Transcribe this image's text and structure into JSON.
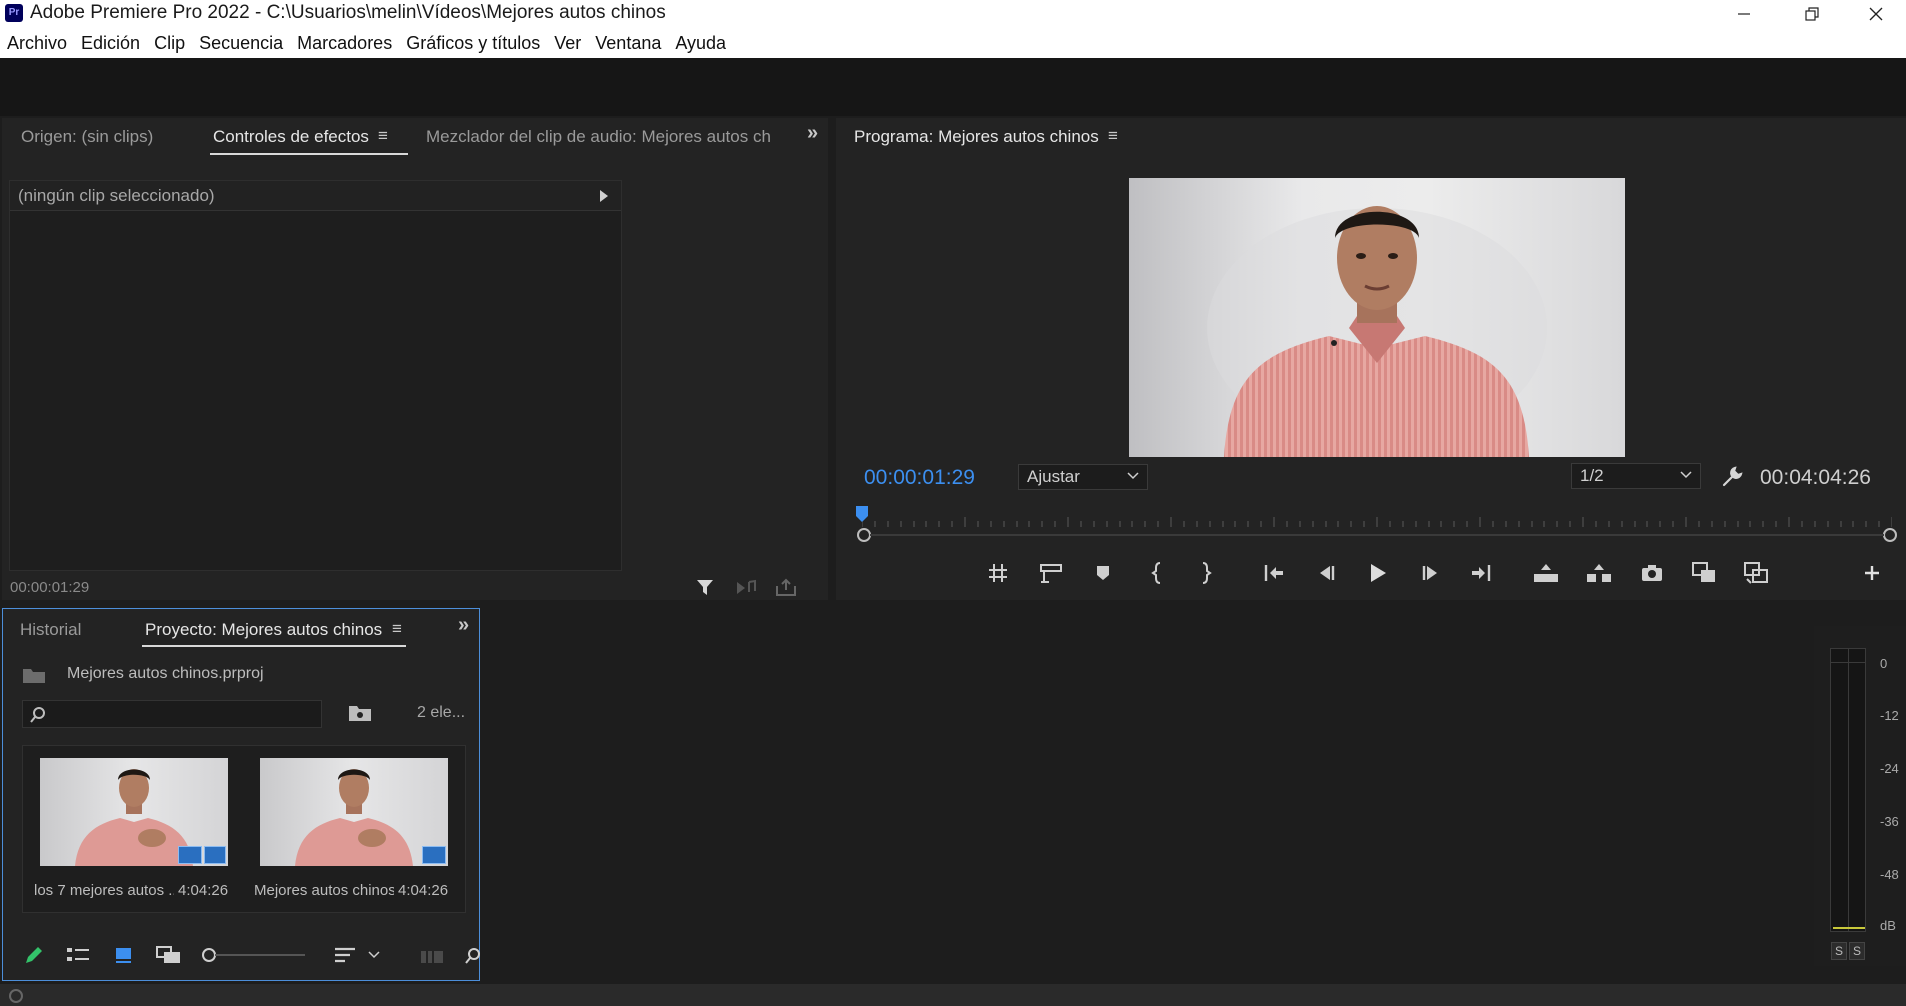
{
  "window": {
    "app_icon": "Pr",
    "title": "Adobe Premiere Pro 2022 - C:\\Usuarios\\melin\\Vídeos\\Mejores autos chinos"
  },
  "menubar": [
    "Archivo",
    "Edición",
    "Clip",
    "Secuencia",
    "Marcadores",
    "Gráficos y títulos",
    "Ver",
    "Ventana",
    "Ayuda"
  ],
  "source_panel": {
    "tabs": [
      "Origen: (sin clips)",
      "Controles de efectos",
      "Mezclador del clip de audio: Mejores autos chi"
    ],
    "active_tab": "Controles de efectos",
    "no_clip_text": "(ningún clip seleccionado)",
    "timecode": "00:00:01:29"
  },
  "program_panel": {
    "title": "Programa: Mejores autos chinos",
    "current_timecode": "00:00:01:29",
    "zoom": "Ajustar",
    "resolution": "1/2",
    "duration": "00:04:04:26",
    "playhead_fraction": 0.0
  },
  "project_panel": {
    "tabs": [
      "Historial",
      "Proyecto: Mejores autos chinos"
    ],
    "active_tab": "Proyecto: Mejores autos chinos",
    "project_file": "Mejores autos chinos.prproj",
    "search_placeholder": "",
    "item_count": "2 ele...",
    "items": [
      {
        "name": "los 7 mejores autos ...",
        "duration": "4:04:26"
      },
      {
        "name": "Mejores autos chinos",
        "duration": "4:04:26"
      }
    ]
  },
  "audio_meter": {
    "scale": [
      "0",
      "-12",
      "-24",
      "-36",
      "-48",
      "dB"
    ],
    "solo_labels": [
      "S",
      "S"
    ]
  },
  "colors": {
    "accent_blue": "#3c8ff0",
    "panel_bg": "#232323",
    "focus_border": "#4c8ed9"
  }
}
